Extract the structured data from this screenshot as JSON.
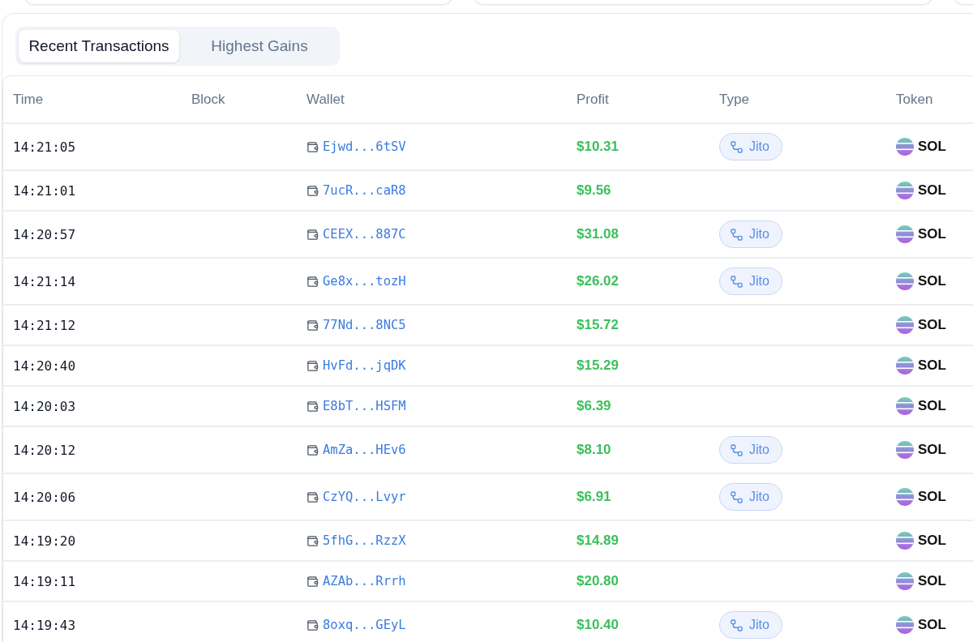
{
  "tabs": [
    {
      "label": "Recent Transactions",
      "selected": true
    },
    {
      "label": "Highest Gains",
      "selected": false
    }
  ],
  "table": {
    "columns": [
      "Time",
      "Block",
      "Wallet",
      "Profit",
      "Type",
      "Token"
    ],
    "rows": [
      {
        "time": "14:21:05",
        "wallet": "Ejwd...6tSV",
        "profit": "$10.31",
        "type": "Jito",
        "token": "SOL"
      },
      {
        "time": "14:21:01",
        "wallet": "7ucR...caR8",
        "profit": "$9.56",
        "token": "SOL"
      },
      {
        "time": "14:20:57",
        "wallet": "CEEX...887C",
        "profit": "$31.08",
        "type": "Jito",
        "token": "SOL"
      },
      {
        "time": "14:21:14",
        "wallet": "Ge8x...tozH",
        "profit": "$26.02",
        "type": "Jito",
        "token": "SOL"
      },
      {
        "time": "14:21:12",
        "wallet": "77Nd...8NC5",
        "profit": "$15.72",
        "token": "SOL"
      },
      {
        "time": "14:20:40",
        "wallet": "HvFd...jqDK",
        "profit": "$15.29",
        "token": "SOL"
      },
      {
        "time": "14:20:03",
        "wallet": "E8bT...HSFM",
        "profit": "$6.39",
        "token": "SOL"
      },
      {
        "time": "14:20:12",
        "wallet": "AmZa...HEv6",
        "profit": "$8.10",
        "type": "Jito",
        "token": "SOL"
      },
      {
        "time": "14:20:06",
        "wallet": "CzYQ...Lvyr",
        "profit": "$6.91",
        "type": "Jito",
        "token": "SOL"
      },
      {
        "time": "14:19:20",
        "wallet": "5fhG...RzzX",
        "profit": "$14.89",
        "token": "SOL"
      },
      {
        "time": "14:19:11",
        "wallet": "AZAb...Rrrh",
        "profit": "$20.80",
        "token": "SOL"
      },
      {
        "time": "14:19:43",
        "wallet": "8oxq...GEyL",
        "profit": "$10.40",
        "type": "Jito",
        "token": "SOL"
      }
    ]
  }
}
